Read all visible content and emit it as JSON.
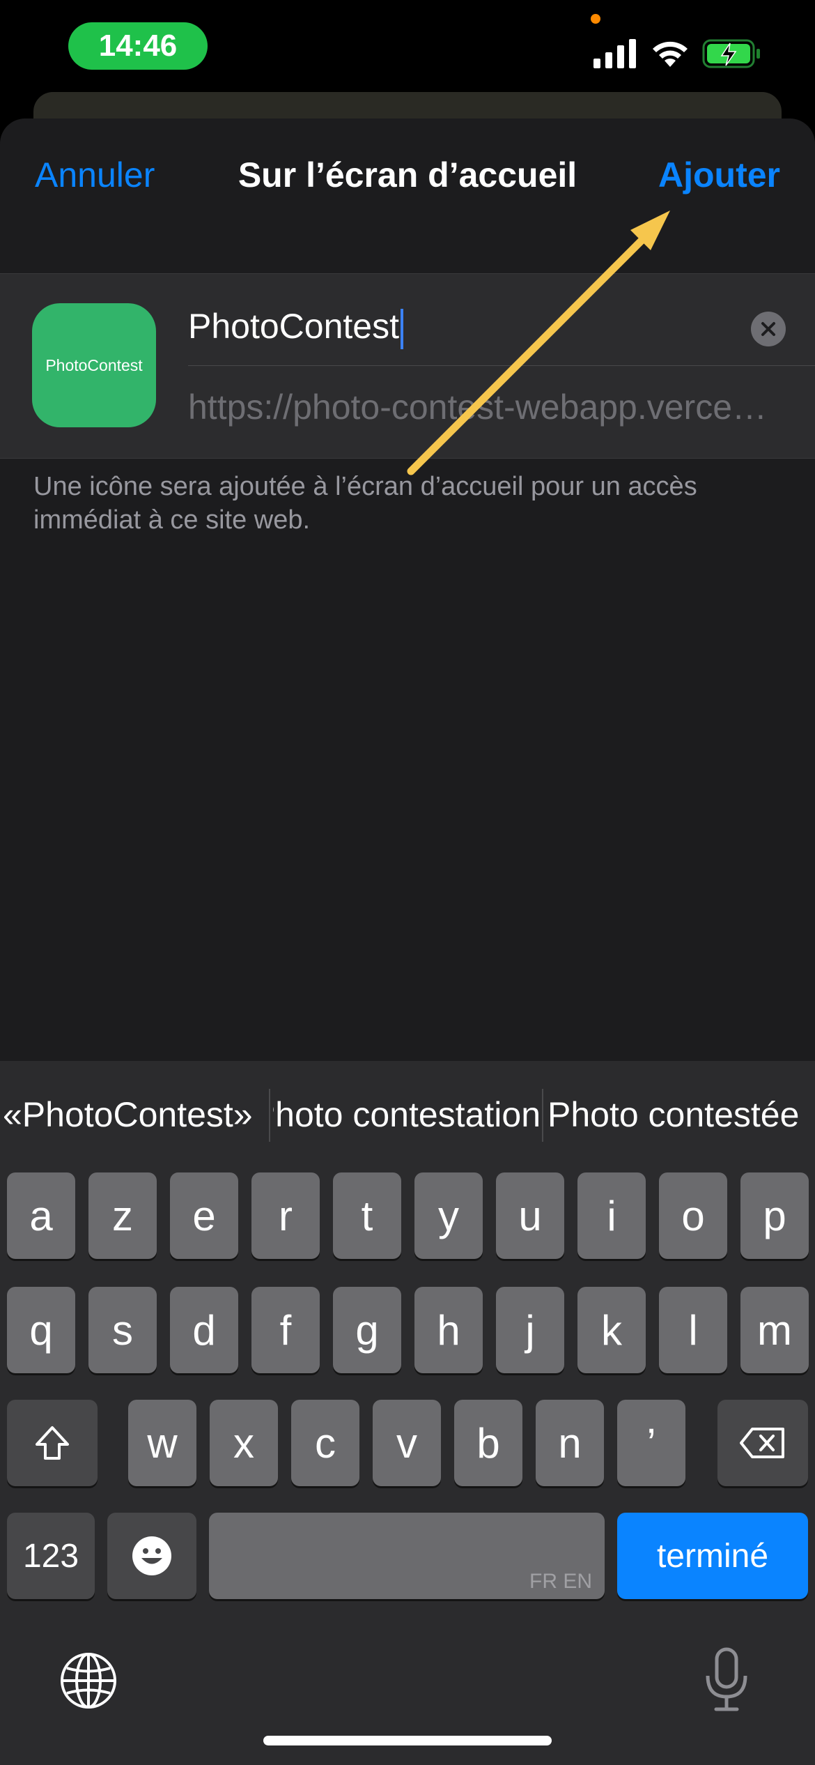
{
  "status_bar": {
    "time": "14:46",
    "icons": [
      "signal-icon",
      "wifi-icon",
      "battery-charging-icon"
    ],
    "time_pill_color": "#1fc14a"
  },
  "nav": {
    "cancel_label": "Annuler",
    "title": "Sur l’écran d’accueil",
    "add_label": "Ajouter",
    "accent_color": "#0a84ff"
  },
  "form": {
    "icon_label": "PhotoContest",
    "icon_color": "#32b46a",
    "name_value": "PhotoContest",
    "url_value": "https://photo-contest-webapp.vercel.app",
    "footer_text": "Une icône sera ajoutée à l’écran d’accueil pour un accès immédiat à ce site web."
  },
  "annotation": {
    "type": "arrow",
    "color": "#f6c64d",
    "points_to": "add-button"
  },
  "keyboard": {
    "suggestions": [
      "«PhotoContest»",
      "Photo contestation",
      "Photo contestée"
    ],
    "row1": [
      "a",
      "z",
      "e",
      "r",
      "t",
      "y",
      "u",
      "i",
      "o",
      "p"
    ],
    "row2": [
      "q",
      "s",
      "d",
      "f",
      "g",
      "h",
      "j",
      "k",
      "l",
      "m"
    ],
    "row3": [
      "w",
      "x",
      "c",
      "v",
      "b",
      "n",
      "’"
    ],
    "numbers_label": "123",
    "space_languages": "FR EN",
    "done_label": "terminé",
    "done_color": "#0a84ff"
  }
}
